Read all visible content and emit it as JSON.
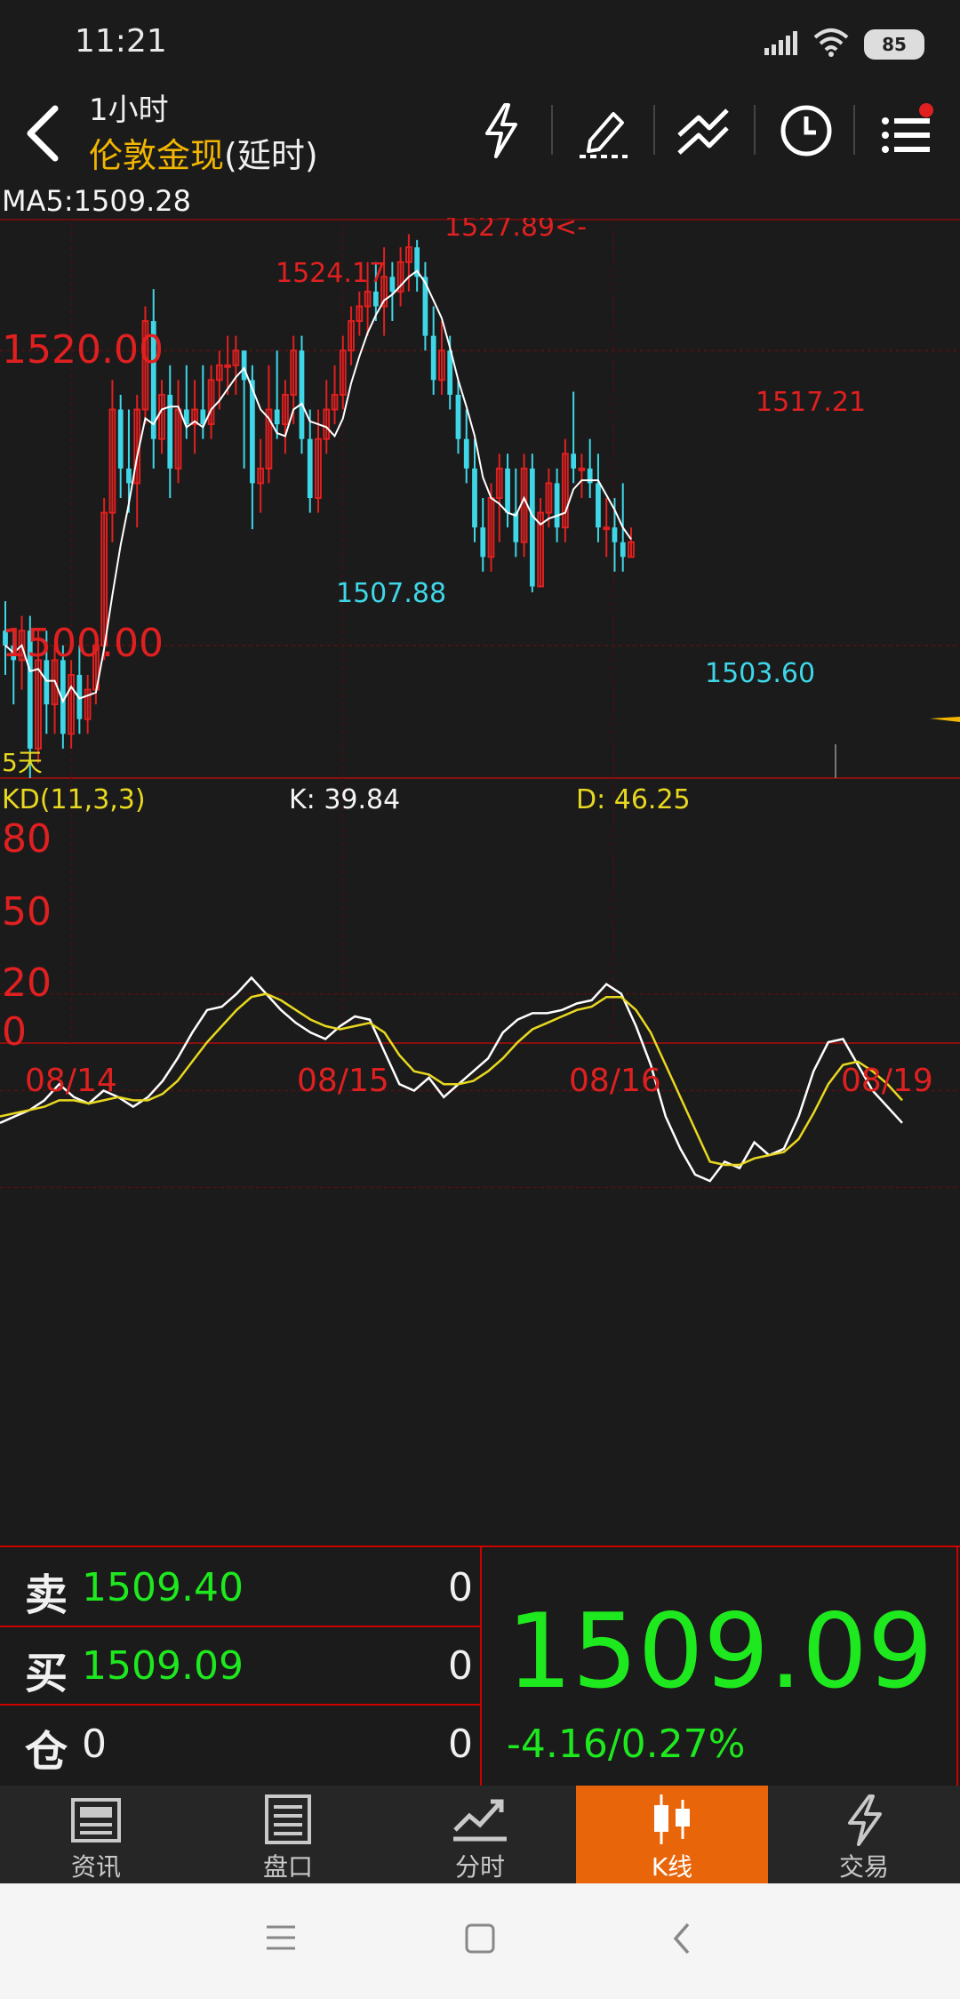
{
  "status_bar": {
    "time": "11:21",
    "battery": "85"
  },
  "header": {
    "timeframe": "1小时",
    "symbol": "伦敦金现",
    "delay": "(延时)",
    "icons": [
      "lightning-icon",
      "draw-pen-icon",
      "trend-lines-icon",
      "clock-icon",
      "menu-list-icon"
    ]
  },
  "ma_label": "MA5:1509.28",
  "chart_data": [
    {
      "type": "candlestick",
      "title": "",
      "y_labels": [
        "1520.00",
        "1500.00"
      ],
      "range_label": "5天",
      "annotations": [
        {
          "text": "1527.89<-",
          "color": "#e02020"
        },
        {
          "text": "1524.17",
          "color": "#e02020"
        },
        {
          "text": "1517.21",
          "color": "#e02020"
        },
        {
          "text": "1507.88",
          "color": "#3fd7e8"
        },
        {
          "text": "1503.60",
          "color": "#3fd7e8"
        }
      ],
      "candles": [
        [
          1501,
          1503,
          1498,
          1500
        ],
        [
          1500,
          1501,
          1496,
          1499
        ],
        [
          1499,
          1502,
          1497,
          1501
        ],
        [
          1501,
          1502,
          1491,
          1493
        ],
        [
          1493,
          1501,
          1492,
          1499
        ],
        [
          1499,
          1501,
          1494,
          1496
        ],
        [
          1496,
          1500,
          1494,
          1499
        ],
        [
          1499,
          1500,
          1493,
          1494
        ],
        [
          1494,
          1499,
          1493,
          1498
        ],
        [
          1498,
          1500,
          1494,
          1495
        ],
        [
          1495,
          1498,
          1494,
          1497
        ],
        [
          1497,
          1500,
          1496,
          1500
        ],
        [
          1500,
          1510,
          1499,
          1509
        ],
        [
          1509,
          1518,
          1507,
          1516
        ],
        [
          1516,
          1517,
          1510,
          1512
        ],
        [
          1512,
          1516,
          1509,
          1511
        ],
        [
          1511,
          1517,
          1508,
          1516
        ],
        [
          1516,
          1523,
          1515,
          1522
        ],
        [
          1522,
          1524.17,
          1512,
          1514
        ],
        [
          1514,
          1518,
          1513,
          1517
        ],
        [
          1517,
          1519,
          1510,
          1512
        ],
        [
          1512,
          1518,
          1511,
          1516
        ],
        [
          1516,
          1519,
          1514,
          1515
        ],
        [
          1515,
          1518,
          1513,
          1516
        ],
        [
          1516,
          1519,
          1514,
          1515
        ],
        [
          1515,
          1519,
          1514,
          1518
        ],
        [
          1518,
          1520,
          1516,
          1519
        ],
        [
          1519,
          1521,
          1517,
          1519
        ],
        [
          1519,
          1521,
          1517,
          1520
        ],
        [
          1520,
          1520,
          1512,
          1518
        ],
        [
          1518,
          1519,
          1507.88,
          1511
        ],
        [
          1511,
          1514,
          1509,
          1512
        ],
        [
          1512,
          1519,
          1511,
          1516
        ],
        [
          1516,
          1520,
          1514,
          1515
        ],
        [
          1515,
          1518,
          1513,
          1517
        ],
        [
          1517,
          1521,
          1515,
          1520
        ],
        [
          1520,
          1521,
          1513,
          1514
        ],
        [
          1514,
          1516,
          1509,
          1510
        ],
        [
          1510,
          1516,
          1509,
          1514
        ],
        [
          1514,
          1518,
          1513,
          1516
        ],
        [
          1516,
          1519,
          1515,
          1517
        ],
        [
          1517,
          1521,
          1516,
          1520
        ],
        [
          1520,
          1523,
          1519,
          1522
        ],
        [
          1522,
          1524,
          1521,
          1523
        ],
        [
          1523,
          1526,
          1521,
          1524
        ],
        [
          1524,
          1526,
          1522,
          1523
        ],
        [
          1523,
          1527,
          1521,
          1525
        ],
        [
          1525,
          1526,
          1522,
          1524
        ],
        [
          1524,
          1527,
          1523,
          1526
        ],
        [
          1526,
          1527.89,
          1524,
          1527
        ],
        [
          1527,
          1527.5,
          1524,
          1525
        ],
        [
          1525,
          1526,
          1520,
          1521
        ],
        [
          1521,
          1523,
          1517,
          1518
        ],
        [
          1518,
          1522,
          1517,
          1520
        ],
        [
          1520,
          1521,
          1516,
          1517
        ],
        [
          1517,
          1518,
          1513,
          1514
        ],
        [
          1514,
          1516,
          1511,
          1512
        ],
        [
          1512,
          1514,
          1507,
          1508
        ],
        [
          1508,
          1510,
          1505,
          1506
        ],
        [
          1506,
          1511,
          1505,
          1510
        ],
        [
          1510,
          1513,
          1507,
          1512
        ],
        [
          1512,
          1513,
          1508,
          1509
        ],
        [
          1509,
          1512,
          1506,
          1507
        ],
        [
          1507,
          1513,
          1506,
          1512
        ],
        [
          1512,
          1513,
          1503.6,
          1504
        ],
        [
          1504,
          1510,
          1504,
          1509
        ],
        [
          1509,
          1512,
          1508,
          1511
        ],
        [
          1511,
          1512,
          1507,
          1508
        ],
        [
          1508,
          1514,
          1507,
          1513
        ],
        [
          1513,
          1517.21,
          1511,
          1512
        ],
        [
          1512,
          1513,
          1510,
          1512
        ],
        [
          1512,
          1514,
          1510,
          1511
        ],
        [
          1511,
          1513,
          1507,
          1508
        ],
        [
          1508,
          1510,
          1506,
          1508
        ],
        [
          1508,
          1510,
          1505,
          1507
        ],
        [
          1507,
          1511,
          1505,
          1506
        ],
        [
          1506,
          1508,
          1506,
          1507
        ]
      ]
    },
    {
      "type": "line",
      "title": "",
      "indicator": "KD(11,3,3)",
      "k_label": "K: 39.84",
      "d_label": "D: 46.25",
      "y_ticks": [
        "80",
        "50",
        "20",
        "0"
      ],
      "x_labels": [
        "08/14",
        "08/15",
        "08/16",
        "08/19"
      ],
      "series": [
        {
          "name": "K",
          "color": "#ffffff",
          "values": [
            40,
            42,
            44,
            47,
            52,
            48,
            46,
            50,
            48,
            45,
            48,
            53,
            60,
            68,
            75,
            76,
            80,
            85,
            80,
            75,
            71,
            68,
            66,
            70,
            73,
            72,
            62,
            52,
            50,
            54,
            48,
            52,
            56,
            60,
            68,
            72,
            74,
            74,
            75,
            77,
            78,
            83,
            80,
            70,
            58,
            42,
            32,
            24,
            22,
            28,
            26,
            34,
            30,
            32,
            42,
            56,
            65,
            66,
            58,
            50,
            45,
            40
          ]
        },
        {
          "name": "D",
          "color": "#e8d820",
          "values": [
            42,
            43,
            44,
            45,
            47,
            47,
            46,
            47,
            48,
            47,
            47,
            49,
            53,
            59,
            65,
            70,
            75,
            79,
            80,
            78,
            75,
            72,
            70,
            69,
            70,
            71,
            68,
            61,
            56,
            55,
            52,
            52,
            53,
            56,
            60,
            65,
            69,
            71,
            73,
            75,
            76,
            79,
            79,
            75,
            68,
            58,
            48,
            38,
            28,
            27,
            27,
            29,
            30,
            31,
            35,
            43,
            52,
            58,
            59,
            56,
            52,
            47
          ]
        }
      ]
    }
  ],
  "quote": {
    "sell_label": "卖",
    "sell_price": "1509.40",
    "sell_vol": "0",
    "buy_label": "买",
    "buy_price": "1509.09",
    "buy_vol": "0",
    "pos_label": "仓",
    "pos_value": "0",
    "pos_vol": "0",
    "last_price": "1509.09",
    "change": "-4.16/0.27%"
  },
  "tabs": [
    {
      "label": "资讯",
      "icon": "news-icon"
    },
    {
      "label": "盘口",
      "icon": "order-book-icon"
    },
    {
      "label": "分时",
      "icon": "timeshare-icon"
    },
    {
      "label": "K线",
      "icon": "candlestick-icon",
      "active": true
    },
    {
      "label": "交易",
      "icon": "trade-lightning-icon"
    }
  ],
  "navbar": [
    "menu-icon",
    "home-square-icon",
    "back-icon"
  ]
}
